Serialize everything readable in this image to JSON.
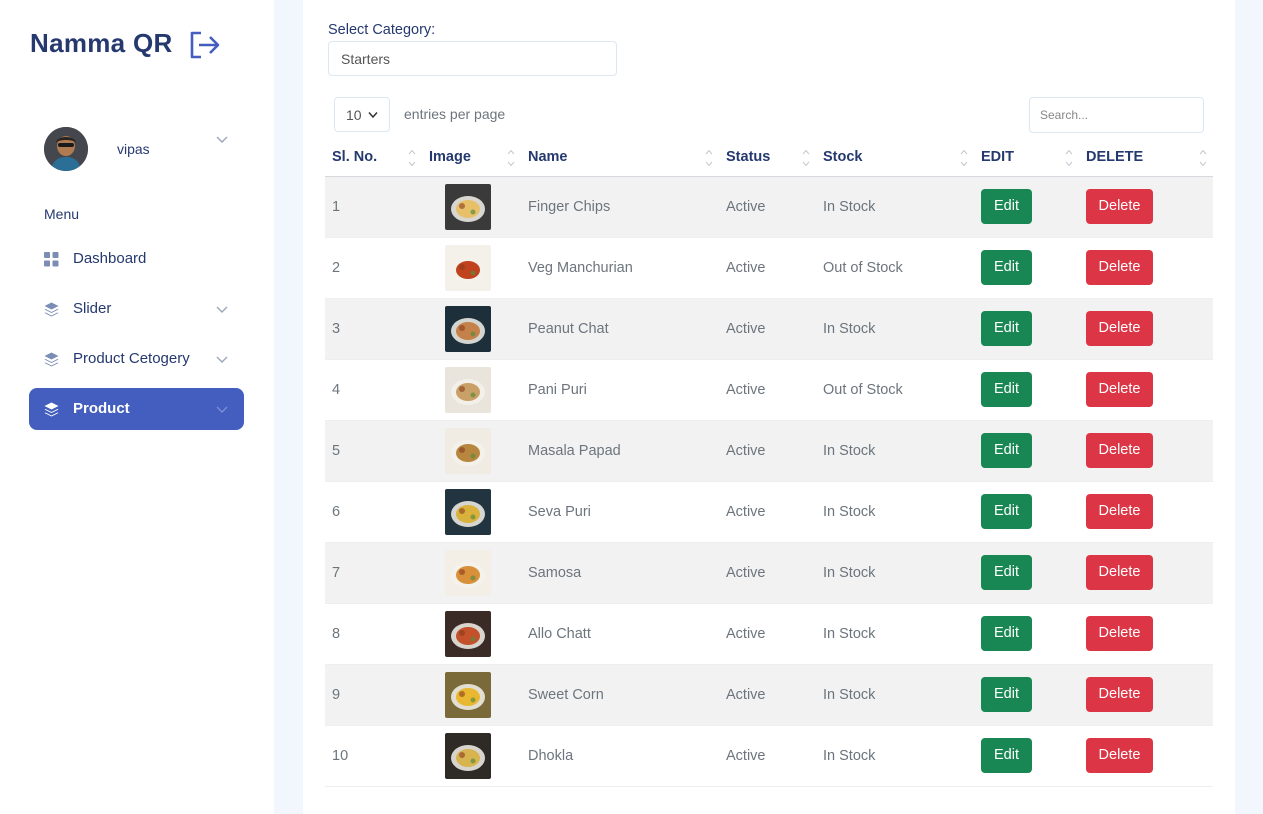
{
  "sidebar": {
    "brand": "Namma QR",
    "user_name": "vipas",
    "menu_title": "Menu",
    "items": [
      {
        "label": "Dashboard",
        "icon": "grid-icon",
        "has_children": false,
        "active": false
      },
      {
        "label": "Slider",
        "icon": "stack-icon",
        "has_children": true,
        "active": false
      },
      {
        "label": "Product Cetogery",
        "icon": "stack-icon",
        "has_children": true,
        "active": false
      },
      {
        "label": "Product",
        "icon": "stack-icon",
        "has_children": true,
        "active": true
      }
    ]
  },
  "filters": {
    "category_label": "Select Category:",
    "category_value": "Starters",
    "per_page_value": "10",
    "per_page_label": "entries per page",
    "search_placeholder": "Search..."
  },
  "table": {
    "columns": [
      "Sl. No.",
      "Image",
      "Name",
      "Status",
      "Stock",
      "EDIT",
      "DELETE"
    ],
    "edit_label": "Edit",
    "delete_label": "Delete",
    "rows": [
      {
        "sl": "1",
        "name": "Finger Chips",
        "status": "Active",
        "stock": "In Stock",
        "thumb_bg": "#3a3a3a",
        "thumb_fg": "#e8c06a"
      },
      {
        "sl": "2",
        "name": "Veg Manchurian",
        "status": "Active",
        "stock": "Out of Stock",
        "thumb_bg": "#f4f0ea",
        "thumb_fg": "#c0431e"
      },
      {
        "sl": "3",
        "name": "Peanut Chat",
        "status": "Active",
        "stock": "In Stock",
        "thumb_bg": "#1d2f3a",
        "thumb_fg": "#c4824a"
      },
      {
        "sl": "4",
        "name": "Pani Puri",
        "status": "Active",
        "stock": "Out of Stock",
        "thumb_bg": "#e9e4dc",
        "thumb_fg": "#c9a067"
      },
      {
        "sl": "5",
        "name": "Masala Papad",
        "status": "Active",
        "stock": "In Stock",
        "thumb_bg": "#f0ece4",
        "thumb_fg": "#b7873f"
      },
      {
        "sl": "6",
        "name": "Seva Puri",
        "status": "Active",
        "stock": "In Stock",
        "thumb_bg": "#22343f",
        "thumb_fg": "#d9b23e"
      },
      {
        "sl": "7",
        "name": "Samosa",
        "status": "Active",
        "stock": "In Stock",
        "thumb_bg": "#f3efe7",
        "thumb_fg": "#d9903a"
      },
      {
        "sl": "8",
        "name": "Allo Chatt",
        "status": "Active",
        "stock": "In Stock",
        "thumb_bg": "#3a2b26",
        "thumb_fg": "#c2512c"
      },
      {
        "sl": "9",
        "name": "Sweet Corn",
        "status": "Active",
        "stock": "In Stock",
        "thumb_bg": "#7a6a3a",
        "thumb_fg": "#e9b830"
      },
      {
        "sl": "10",
        "name": "Dhokla",
        "status": "Active",
        "stock": "In Stock",
        "thumb_bg": "#2e2a26",
        "thumb_fg": "#d8b450"
      }
    ]
  },
  "colors": {
    "primary": "#435ebe",
    "edit": "#198754",
    "delete": "#dc3545",
    "text_dark": "#25396f"
  }
}
